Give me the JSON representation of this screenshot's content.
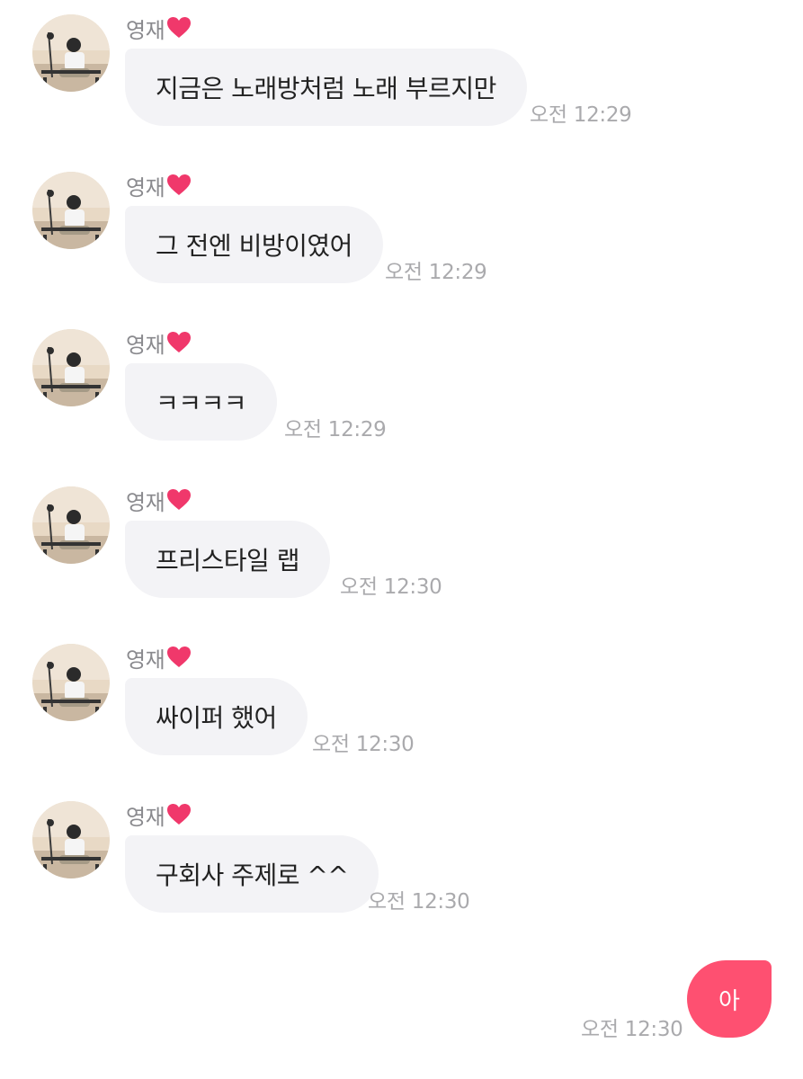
{
  "chat": {
    "sender_name": "영재",
    "messages": [
      {
        "text": "지금은 노래방처럼 노래 부르지만",
        "time": "오전 12:29"
      },
      {
        "text": "그 전엔 비방이였어",
        "time": "오전 12:29"
      },
      {
        "text": "ㅋㅋㅋㅋ",
        "time": "오전 12:29"
      },
      {
        "text": "프리스타일 랩",
        "time": "오전 12:30"
      },
      {
        "text": "싸이퍼 했어",
        "time": "오전 12:30"
      },
      {
        "text": "구회사 주제로 ^^",
        "time": "오전 12:30"
      }
    ],
    "my_message": {
      "text": "아",
      "time": "오전 12:30"
    }
  },
  "colors": {
    "incoming_bubble": "#f3f3f6",
    "outgoing_bubble": "#fe5071",
    "heart": "#f0386b",
    "timestamp": "#aaaaad"
  },
  "icons": {
    "avatar": "profile-photo-icon",
    "heart": "heart-icon"
  }
}
